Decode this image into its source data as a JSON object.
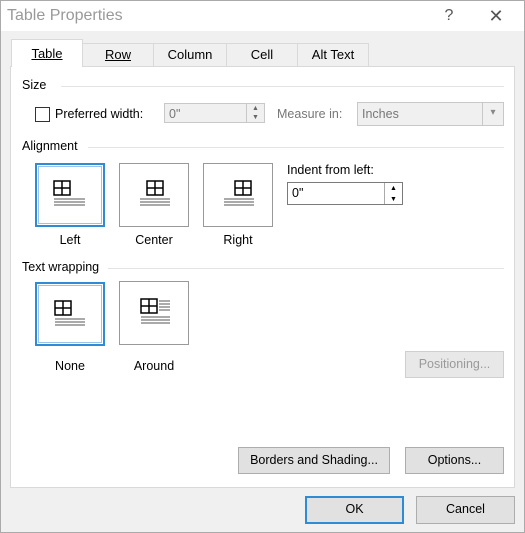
{
  "window": {
    "title": "Table Properties"
  },
  "titlebar": {
    "help_glyph": "?",
    "close_glyph": "✕"
  },
  "tabs": [
    {
      "label": "Table",
      "active": true
    },
    {
      "label": "Row"
    },
    {
      "label": "Column"
    },
    {
      "label": "Cell"
    },
    {
      "label": "Alt Text"
    }
  ],
  "size": {
    "heading": "Size",
    "preferred_width_label": "Preferred width:",
    "preferred_width_value": "0\"",
    "measure_in_label": "Measure in:",
    "measure_in_value": "Inches"
  },
  "alignment": {
    "heading": "Alignment",
    "options": [
      "Left",
      "Center",
      "Right"
    ],
    "selected": "Left",
    "indent_label": "Indent from left:",
    "indent_value": "0\""
  },
  "wrapping": {
    "heading": "Text wrapping",
    "options": [
      "None",
      "Around"
    ],
    "selected": "None",
    "positioning_label": "Positioning..."
  },
  "buttons": {
    "borders": "Borders and Shading...",
    "options": "Options...",
    "ok": "OK",
    "cancel": "Cancel"
  }
}
